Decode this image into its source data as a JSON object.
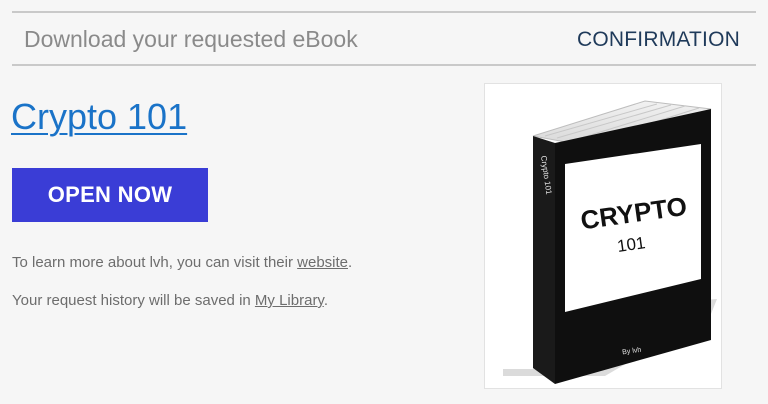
{
  "header": {
    "title": "Download your requested eBook",
    "status": "CONFIRMATION"
  },
  "ebook": {
    "title": "Crypto 101",
    "cta_label": "OPEN NOW",
    "cover": {
      "title_line1": "CRYPTO",
      "title_line2": "101",
      "spine_text": "Crypto 101",
      "author_text": "By lvh"
    }
  },
  "info": {
    "line1_prefix": "To learn more about lvh, you can visit their ",
    "line1_link": "website",
    "line1_suffix": ".",
    "line2_prefix": "Your request history will be saved in ",
    "line2_link": "My Library",
    "line2_suffix": "."
  }
}
